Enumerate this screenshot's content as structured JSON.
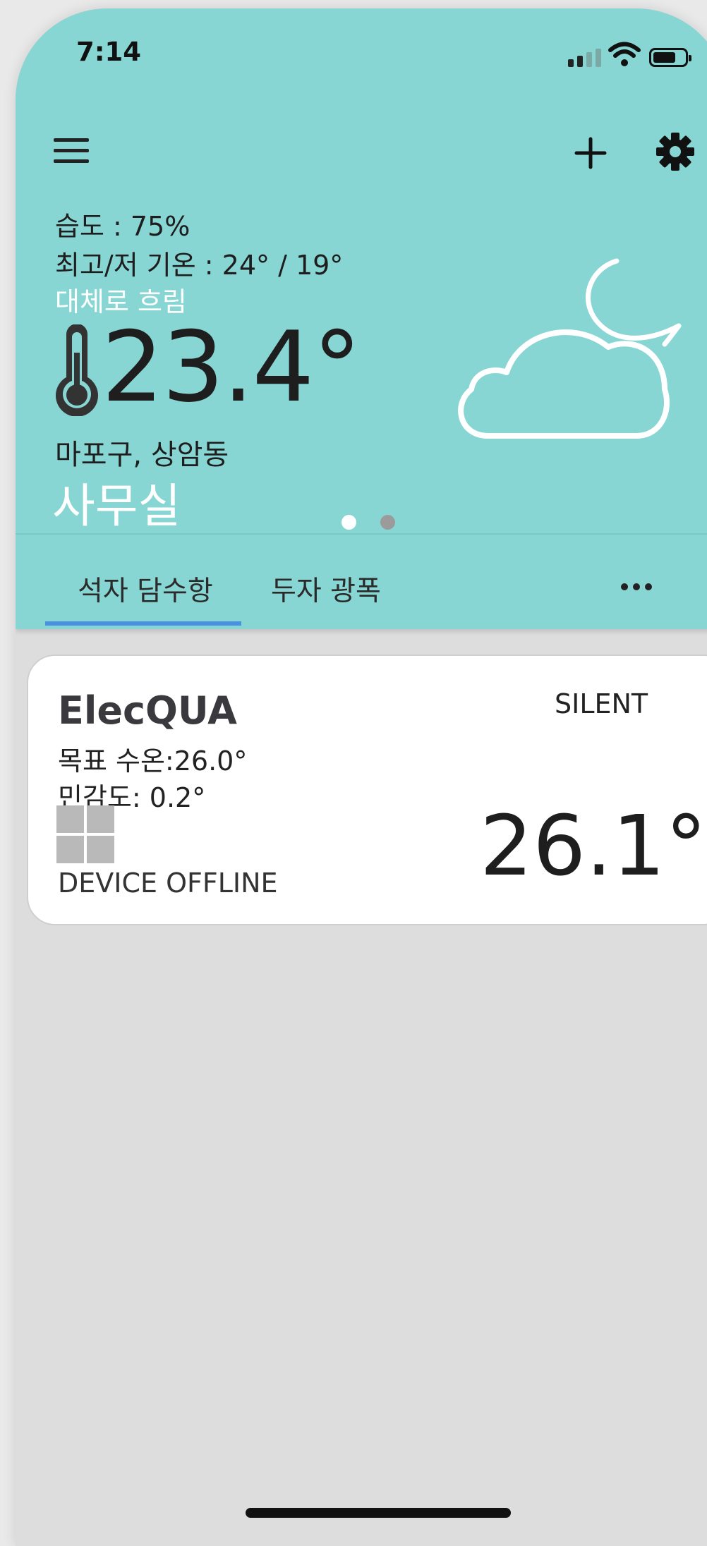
{
  "status_bar": {
    "time": "7:14"
  },
  "weather": {
    "humidity": "습도 : 75%",
    "hi_lo": "최고/저 기온 : 24° / 19°",
    "condition": "대체로 흐림",
    "temperature": "23.4°",
    "location": "마포구, 상암동",
    "place_name": "사무실",
    "icon": "cloud-moon-icon",
    "page_count": 2,
    "current_page": 1
  },
  "tabs": [
    {
      "label": "석자 담수항",
      "selected": true
    },
    {
      "label": "두자 광폭",
      "selected": false
    }
  ],
  "device": {
    "name": "ElecQUA",
    "target_temp": "목표 수온:26.0°",
    "sensitivity": "민감도: 0.2°",
    "mode": "SILENT",
    "status": "DEVICE OFFLINE",
    "current_temp": "26.1°"
  },
  "colors": {
    "header_bg": "#88d6d3",
    "tab_indicator": "#4a90e2",
    "screen_bg": "#dddddd",
    "card_bg": "#ffffff"
  }
}
